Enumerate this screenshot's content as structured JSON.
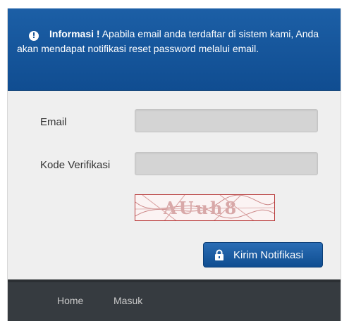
{
  "info": {
    "icon": "exclamation-circle-icon",
    "title": "Informasi !",
    "message": "Apabila email anda terdaftar di sistem kami, Anda akan mendapat notifikasi reset password melalui email."
  },
  "form": {
    "email_label": "Email",
    "email_value": "",
    "verification_label": "Kode Verifikasi",
    "verification_value": "",
    "captcha_text": "AUuh8"
  },
  "submit": {
    "icon": "lock-icon",
    "label": "Kirim Notifikasi"
  },
  "footer": {
    "links": [
      "Home",
      "Masuk"
    ]
  },
  "colors": {
    "info_background": "#104d91",
    "button_background": "#1559a3",
    "footer_background": "#363b40",
    "page_background": "#efefef"
  }
}
